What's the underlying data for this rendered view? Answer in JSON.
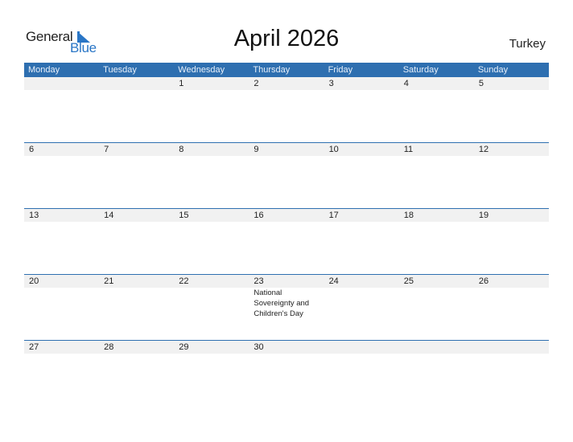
{
  "logo": {
    "part1": "General",
    "part2": "Blue",
    "accent": "#2a76c6"
  },
  "header": {
    "title": "April 2026",
    "country": "Turkey"
  },
  "colors": {
    "header_bg": "#2e6fb0",
    "row_strip": "#f1f1f1"
  },
  "weekdays": [
    "Monday",
    "Tuesday",
    "Wednesday",
    "Thursday",
    "Friday",
    "Saturday",
    "Sunday"
  ],
  "weeks": [
    {
      "days": [
        {
          "num": ""
        },
        {
          "num": ""
        },
        {
          "num": "1"
        },
        {
          "num": "2"
        },
        {
          "num": "3"
        },
        {
          "num": "4"
        },
        {
          "num": "5"
        }
      ]
    },
    {
      "days": [
        {
          "num": "6"
        },
        {
          "num": "7"
        },
        {
          "num": "8"
        },
        {
          "num": "9"
        },
        {
          "num": "10"
        },
        {
          "num": "11"
        },
        {
          "num": "12"
        }
      ]
    },
    {
      "days": [
        {
          "num": "13"
        },
        {
          "num": "14"
        },
        {
          "num": "15"
        },
        {
          "num": "16"
        },
        {
          "num": "17"
        },
        {
          "num": "18"
        },
        {
          "num": "19"
        }
      ]
    },
    {
      "days": [
        {
          "num": "20"
        },
        {
          "num": "21"
        },
        {
          "num": "22"
        },
        {
          "num": "23",
          "event": "National Sovereignty and Children's Day"
        },
        {
          "num": "24"
        },
        {
          "num": "25"
        },
        {
          "num": "26"
        }
      ]
    },
    {
      "days": [
        {
          "num": "27"
        },
        {
          "num": "28"
        },
        {
          "num": "29"
        },
        {
          "num": "30"
        },
        {
          "num": ""
        },
        {
          "num": ""
        },
        {
          "num": ""
        }
      ]
    }
  ]
}
